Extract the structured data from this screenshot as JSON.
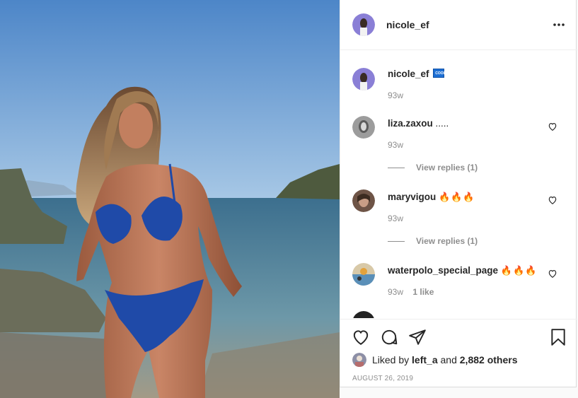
{
  "post": {
    "author": "nicole_ef",
    "photo_alt": "beach photo"
  },
  "caption": {
    "username": "nicole_ef",
    "badge_icon": "cool-emoji-icon",
    "time": "93w"
  },
  "comments": [
    {
      "username": "liza.zaxou",
      "text": ".....",
      "time": "93w",
      "view_replies": "View replies (1)"
    },
    {
      "username": "maryvigou",
      "text": "🔥🔥🔥",
      "time": "93w",
      "view_replies": "View replies (1)"
    },
    {
      "username": "waterpolo_special_page",
      "text": "🔥🔥🔥",
      "time": "93w",
      "likes": "1 like"
    }
  ],
  "likes": {
    "prefix": "Liked by",
    "user": "left_a",
    "connector": "and",
    "others": "2,882 others"
  },
  "date": "AUGUST 26, 2019",
  "icons": {
    "more": "more-options-icon",
    "like": "heart-icon",
    "comment": "comment-icon",
    "share": "share-icon",
    "save": "bookmark-icon"
  },
  "colors": {
    "text": "#262626",
    "muted": "#8e8e8e",
    "border": "#dbdbdb",
    "fire": "#ff5a1f"
  }
}
